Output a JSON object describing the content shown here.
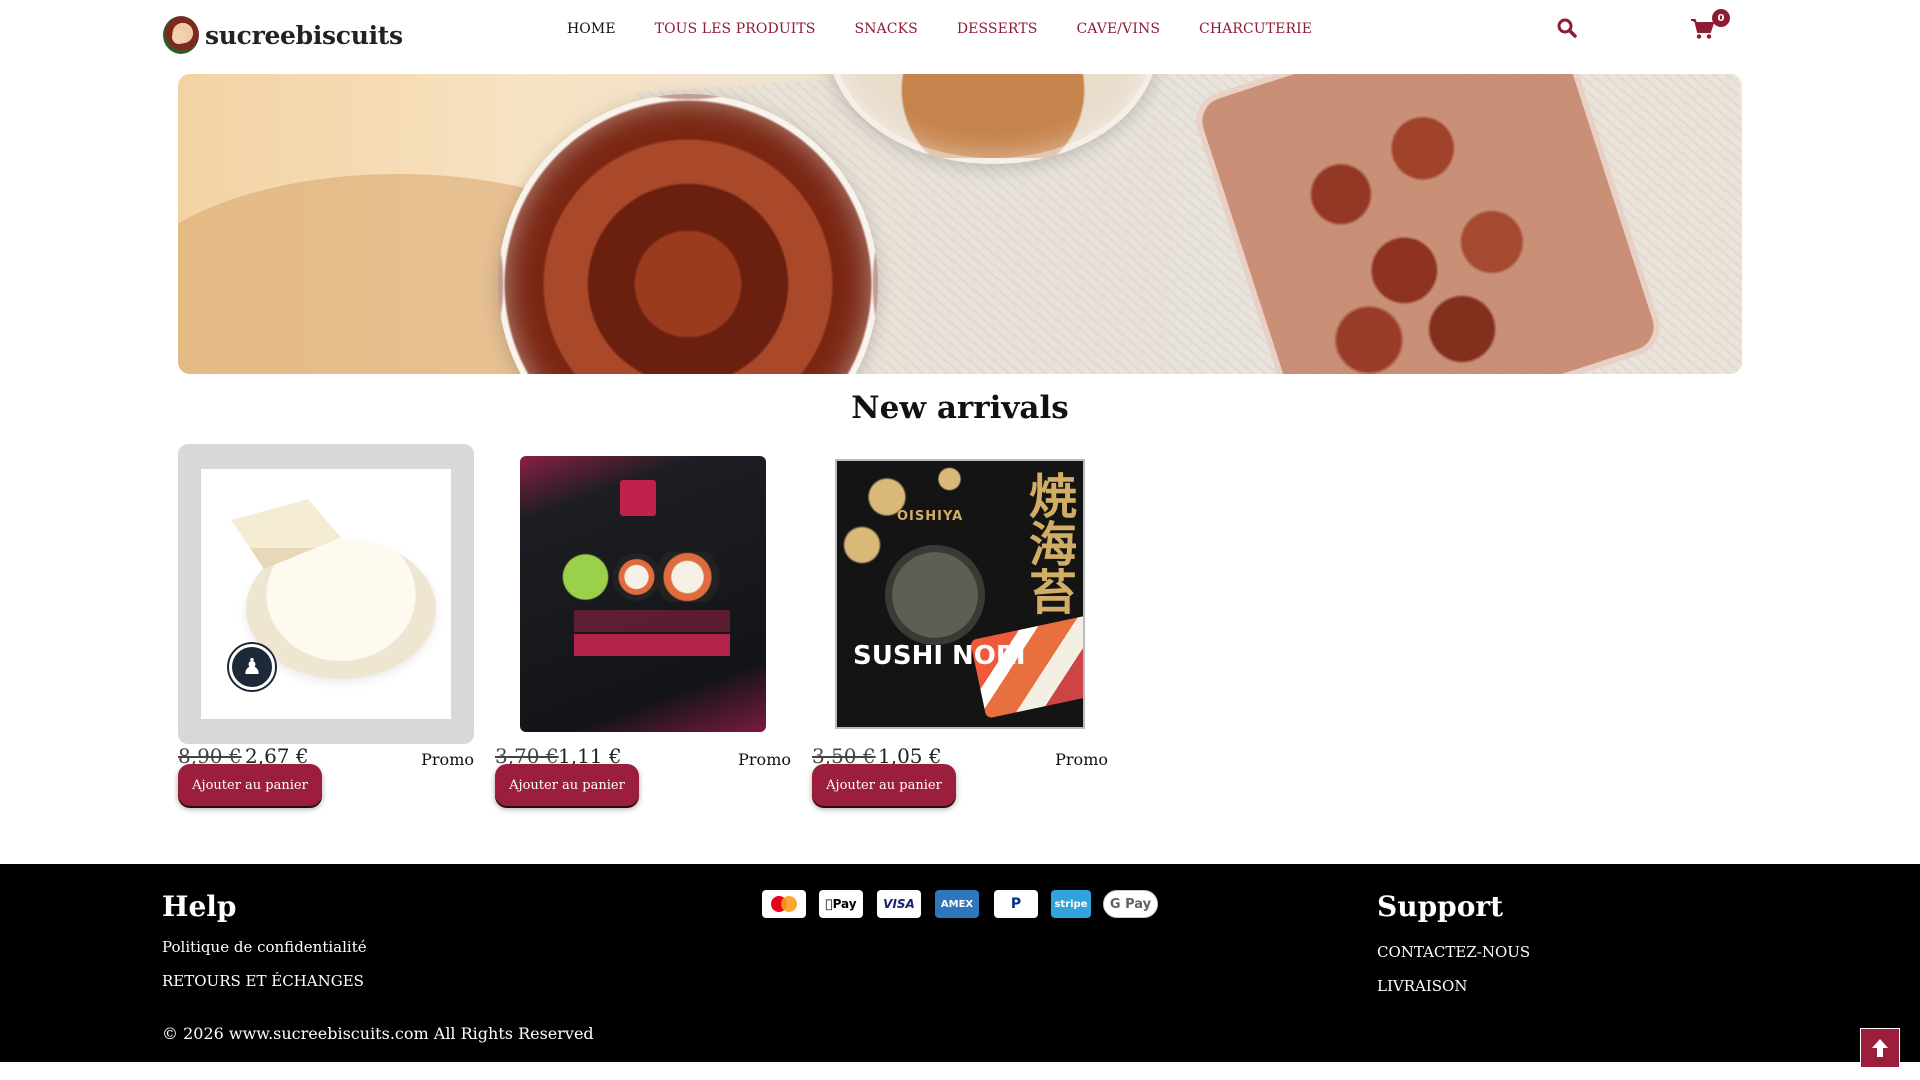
{
  "brand": {
    "name": "sucreebiscuits"
  },
  "nav": {
    "items": [
      {
        "label": "HOME",
        "active": true
      },
      {
        "label": "TOUS LES PRODUITS",
        "active": false
      },
      {
        "label": "SNACKS",
        "active": false
      },
      {
        "label": "DESSERTS",
        "active": false
      },
      {
        "label": "CAVE/VINS",
        "active": false
      },
      {
        "label": "CHARCUTERIE",
        "active": false
      }
    ],
    "search_icon": "search-icon",
    "cart_icon": "cart-icon",
    "cart_count": "0"
  },
  "colors": {
    "accent": "#9b1f3c",
    "nav_link": "#8e1c34",
    "footer_bg": "#000000"
  },
  "new_arrivals": {
    "title": "New arrivals",
    "products": [
      {
        "old_price": "8,90 €",
        "price": "2,67 €",
        "tag": "Promo",
        "button": "Ajouter au panier"
      },
      {
        "old_price": "3,70 €",
        "price": "1,11 €",
        "tag": "Promo",
        "button": "Ajouter au panier"
      },
      {
        "old_price": "3,50 €",
        "price": "1,05 €",
        "tag": "Promo",
        "button": "Ajouter au panier"
      }
    ]
  },
  "product_art": {
    "nori_brand": "OISHIYA",
    "nori_kanji": "焼海苔",
    "nori_title": "SUSHI NORI"
  },
  "footer": {
    "help": {
      "title": "Help",
      "links": [
        "Politique de confidentialité",
        "RETOURS ET ÉCHANGES"
      ]
    },
    "payments": [
      "mastercard-icon",
      "apple-pay-icon",
      "visa-icon",
      "amex-icon",
      "paypal-icon",
      "stripe-icon",
      "google-pay-icon"
    ],
    "payment_labels": {
      "applepay": "Pay",
      "visa": "VISA",
      "amex": "AMEX",
      "paypal": "P",
      "stripe": "stripe",
      "gpay": "G Pay"
    },
    "support": {
      "title": "Support",
      "links": [
        "CONTACTEZ-NOUS",
        "LIVRAISON"
      ]
    },
    "copyright": "© 2026 www.sucreebiscuits.com All Rights Reserved"
  }
}
